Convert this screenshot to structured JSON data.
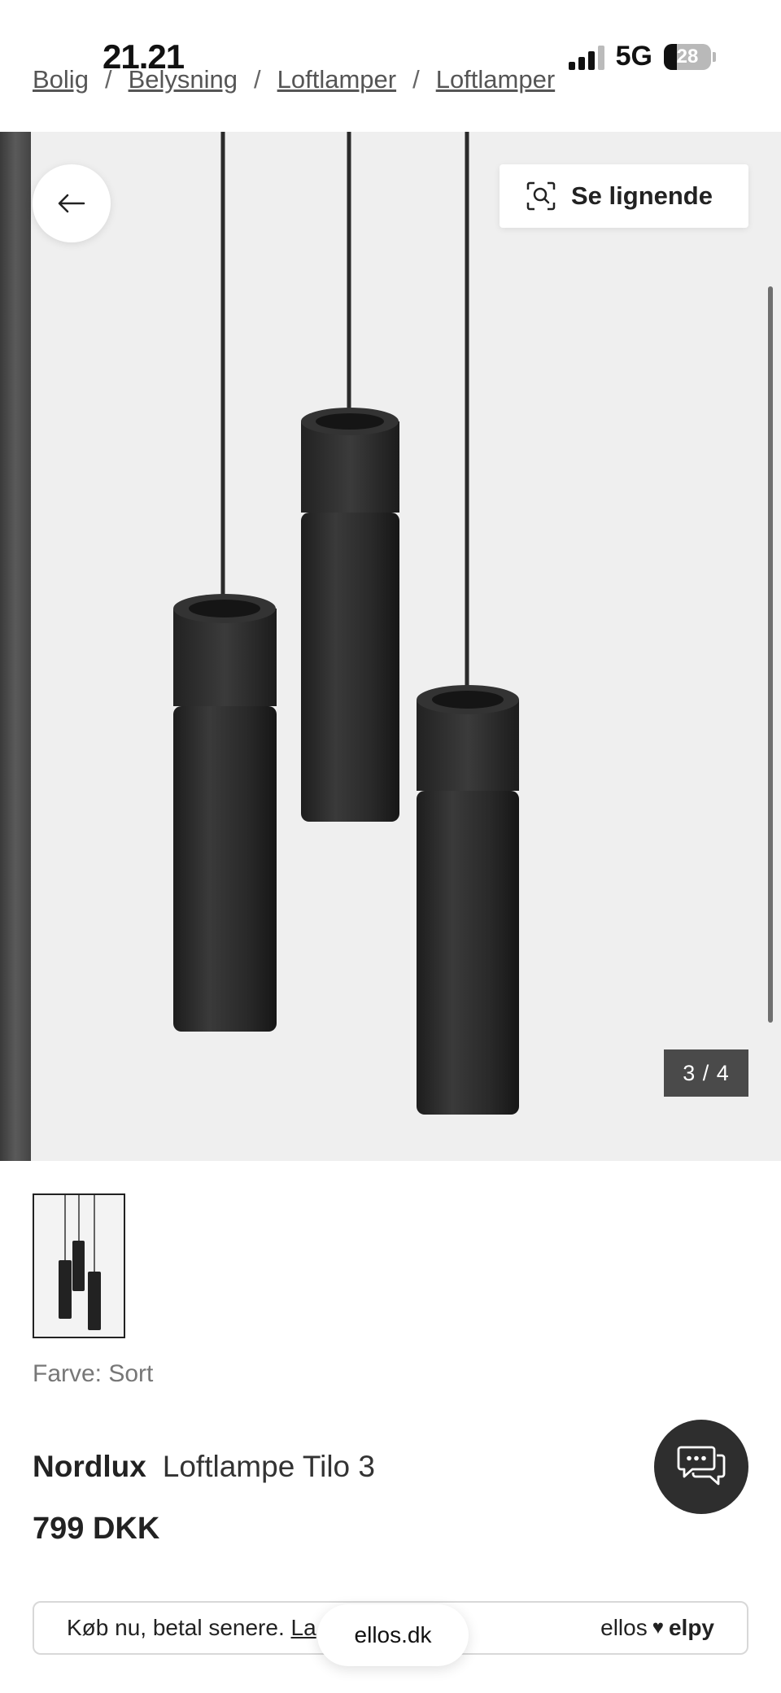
{
  "status_bar": {
    "time": "21.21",
    "network": "5G",
    "battery": "28"
  },
  "breadcrumb": [
    "Bolig",
    "Belysning",
    "Loftlamper",
    "Loftlamper"
  ],
  "gallery": {
    "similar_label": "Se lignende",
    "counter": "3 / 4"
  },
  "product": {
    "color_label": "Farve: Sort",
    "brand": "Nordlux",
    "name": "Loftlampe Tilo 3",
    "price": "799 DKK"
  },
  "payment": {
    "text": "Køb nu, betal senere.",
    "link": "La",
    "brand_left": "ellos",
    "brand_right": "elpy"
  },
  "browser": {
    "url": "ellos.dk"
  },
  "icons": {
    "back": "arrow-left-icon",
    "similar": "visual-search-icon",
    "chat": "chat-bubbles-icon",
    "heart": "heart-icon"
  }
}
